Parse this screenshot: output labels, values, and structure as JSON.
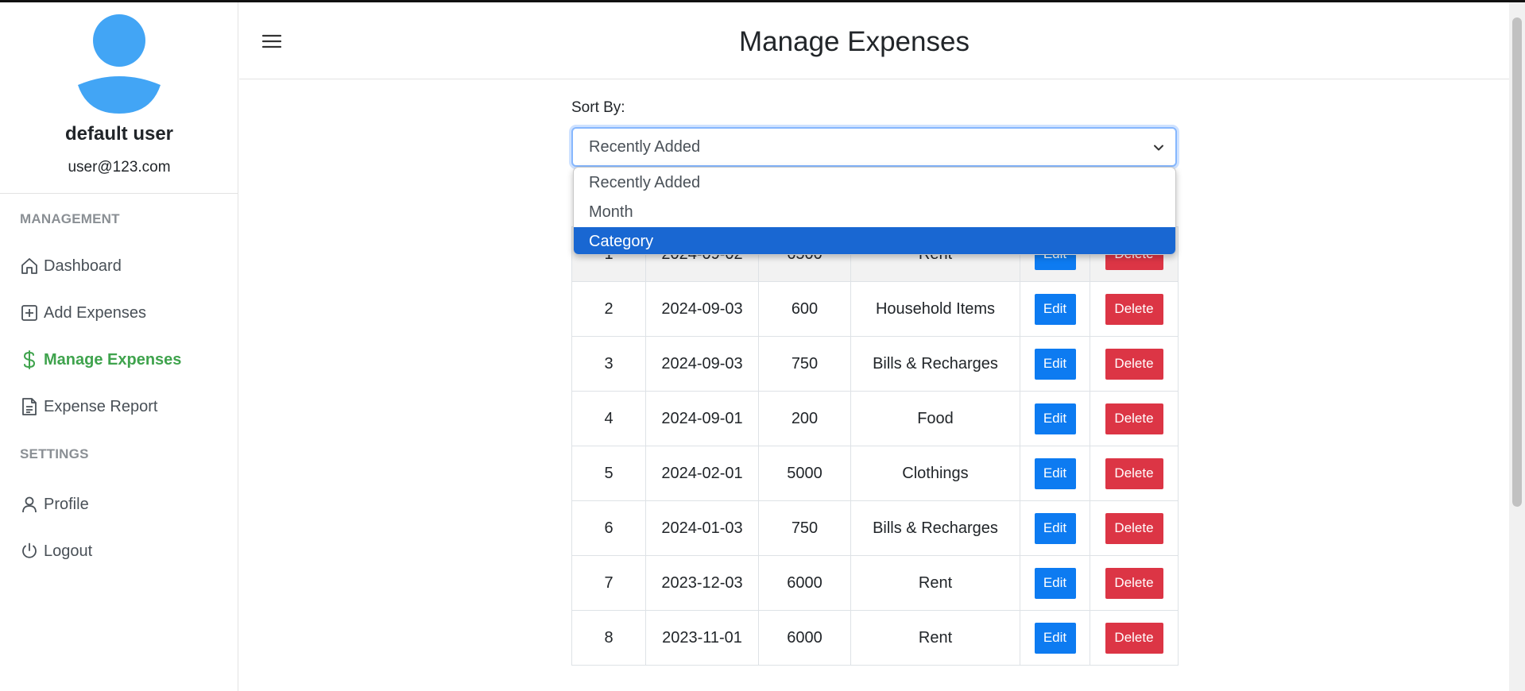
{
  "colors": {
    "accent_active": "#3fa34d",
    "avatar": "#42a5f5",
    "edit_button": "#0d7bf1",
    "delete_button": "#dc3545",
    "dropdown_selected": "#1967d2"
  },
  "user": {
    "name": "default user",
    "email": "user@123.com"
  },
  "sidebar": {
    "management_heading": "MANAGEMENT",
    "settings_heading": "SETTINGS",
    "items": [
      {
        "label": "Dashboard",
        "icon": "home-icon"
      },
      {
        "label": "Add Expenses",
        "icon": "plus-square-icon"
      },
      {
        "label": "Manage Expenses",
        "icon": "dollar-icon",
        "active": true
      },
      {
        "label": "Expense Report",
        "icon": "document-icon"
      },
      {
        "label": "Profile",
        "icon": "person-icon"
      },
      {
        "label": "Logout",
        "icon": "power-icon"
      }
    ]
  },
  "header": {
    "title": "Manage Expenses"
  },
  "sort": {
    "label": "Sort By:",
    "selected": "Recently Added",
    "options": [
      "Recently Added",
      "Month",
      "Category"
    ],
    "highlighted_option": "Category"
  },
  "table": {
    "edit_label": "Edit",
    "delete_label": "Delete",
    "rows": [
      {
        "id": "1",
        "date": "2024-09-02",
        "amount": "6500",
        "category": "Rent"
      },
      {
        "id": "2",
        "date": "2024-09-03",
        "amount": "600",
        "category": "Household Items"
      },
      {
        "id": "3",
        "date": "2024-09-03",
        "amount": "750",
        "category": "Bills & Recharges"
      },
      {
        "id": "4",
        "date": "2024-09-01",
        "amount": "200",
        "category": "Food"
      },
      {
        "id": "5",
        "date": "2024-02-01",
        "amount": "5000",
        "category": "Clothings"
      },
      {
        "id": "6",
        "date": "2024-01-03",
        "amount": "750",
        "category": "Bills & Recharges"
      },
      {
        "id": "7",
        "date": "2023-12-03",
        "amount": "6000",
        "category": "Rent"
      },
      {
        "id": "8",
        "date": "2023-11-01",
        "amount": "6000",
        "category": "Rent"
      }
    ]
  }
}
